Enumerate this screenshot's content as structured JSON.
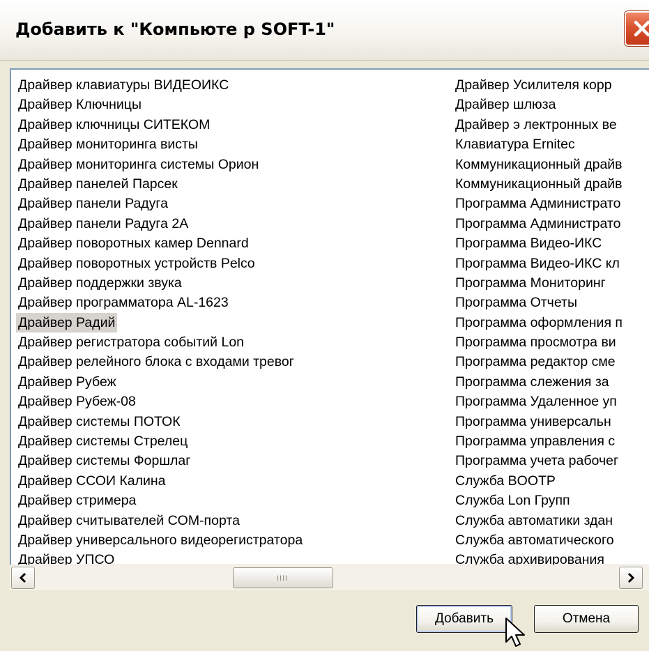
{
  "window": {
    "title": "Добавить к \"Компьюте р SOFT-1\""
  },
  "list": {
    "left_items": [
      "Драйвер клавиатуры ВИДЕОИКС",
      "Драйвер Ключницы",
      "Драйвер ключницы СИТЕКОМ",
      "Драйвер мониторинга висты",
      "Драйвер мониторинга системы Орион",
      "Драйвер панелей Парсек",
      "Драйвер панели Радуга",
      "Драйвер панели Радуга 2А",
      "Драйвер поворотных камер Dennard",
      "Драйвер поворотных устройств Pelco",
      "Драйвер поддержки звука",
      "Драйвер программатора AL-1623",
      "Драйвер Радий",
      "Драйвер регистратора событий Lon",
      "Драйвер релейного блока с входами тревог",
      "Драйвер Рубеж",
      "Драйвер Рубеж-08",
      "Драйвер системы ПОТОК",
      "Драйвер системы Стрелец",
      "Драйвер системы Форшлаг",
      "Драйвер ССОИ Калина",
      "Драйвер стримера",
      "Драйвер считывателей COM-порта",
      "Драйвер универсального видеорегистратора",
      "Драйвер УПСО"
    ],
    "right_items": [
      "Драйвер Усилителя корр",
      "Драйвер шлюза",
      "Драйвер э лектронных ве",
      "Клавиатура Ernitec",
      "Коммуникационный драйв",
      "Коммуникационный драйв",
      "Программа Администрато",
      "Программа Администрато",
      "Программа Видео-ИКС",
      "Программа Видео-ИКС кл",
      "Программа Мониторинг",
      "Программа Отчеты",
      "Программа оформления п",
      "Программа просмотра ви",
      "Программа редактор сме",
      "Программа слежения за",
      "Программа Удаленное уп",
      "Программа универсальн",
      "Программа управления с",
      "Программа учета рабочег",
      "Служба BOOTP",
      "Служба Lon Групп",
      "Служба автоматики здан",
      "Служба автоматического",
      "Служба архивирования"
    ],
    "selected": "Драйвер Радий"
  },
  "scrollbar": {
    "left_arrow": "<",
    "right_arrow": ">",
    "thumb_grip": "IIII"
  },
  "buttons": {
    "add_label": "Добавить",
    "cancel_label": "Отмена"
  },
  "icons": {
    "close": "close-icon",
    "scroll_left": "arrow-left-icon",
    "scroll_right": "arrow-right-icon",
    "cursor": "mouse-cursor-icon"
  }
}
